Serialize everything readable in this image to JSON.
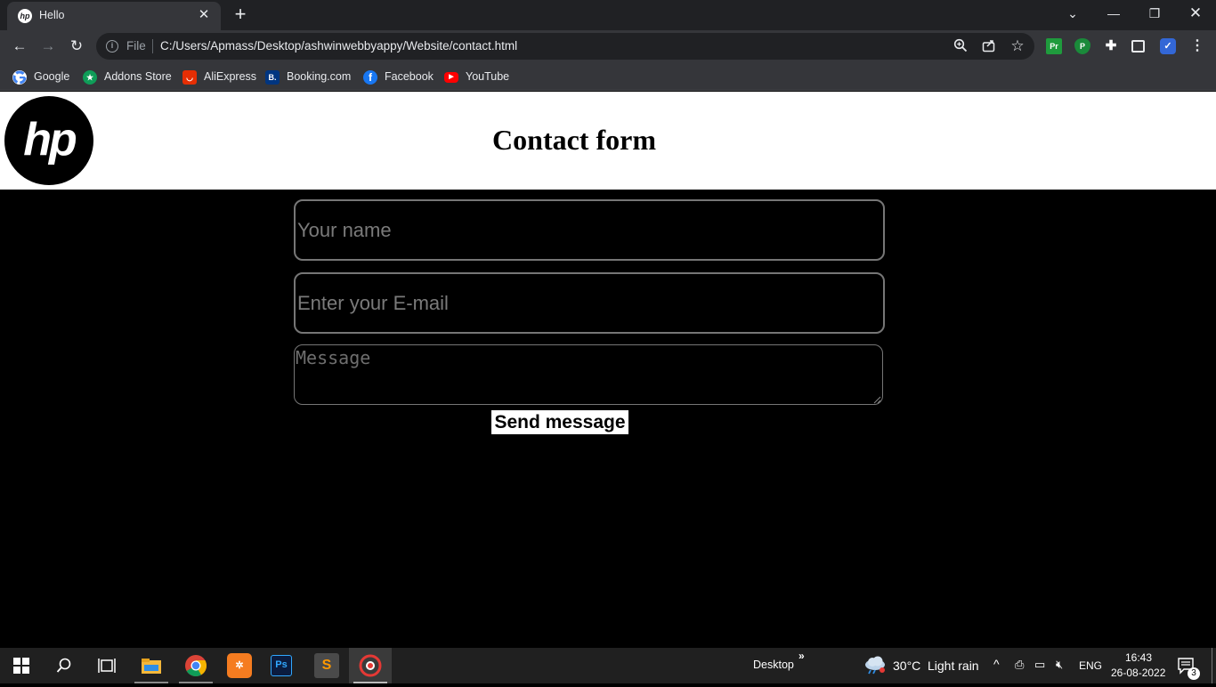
{
  "browser": {
    "tab_title": "Hello",
    "tab_favicon_text": "hp",
    "address_file_label": "File",
    "address_url": "C:/Users/Apmass/Desktop/ashwinwebbyappy/Website/contact.html",
    "extensions": [
      "Pr",
      "P"
    ]
  },
  "bookmarks": [
    {
      "label": "Google",
      "icon": "google-icon",
      "color": "#ffffff"
    },
    {
      "label": "Addons Store",
      "icon": "addons-store-icon",
      "color": "#0f9d58"
    },
    {
      "label": "AliExpress",
      "icon": "aliexpress-icon",
      "color": "#e62e04"
    },
    {
      "label": "Booking.com",
      "icon": "booking-icon",
      "color": "#003580",
      "glyph": "B."
    },
    {
      "label": "Facebook",
      "icon": "facebook-icon",
      "color": "#1877f2",
      "glyph": "f"
    },
    {
      "label": "YouTube",
      "icon": "youtube-icon",
      "color": "#ff0000",
      "glyph": "▶"
    }
  ],
  "page": {
    "title": "Contact form",
    "logo_text": "hp",
    "name_placeholder": "Your name",
    "email_placeholder": "Enter your E-mail",
    "message_placeholder": "Message",
    "send_label": "Send message"
  },
  "taskbar": {
    "photoshop_label": "Ps",
    "desktop_label": "Desktop",
    "desktop_chevron": "»",
    "weather_temp": "30°C",
    "weather_desc": "Light rain",
    "language": "ENG",
    "time": "16:43",
    "date": "26-08-2022",
    "notification_count": "3"
  },
  "colors": {
    "page_background": "#000000",
    "header_background": "#ffffff",
    "chrome_dark": "#202124",
    "chrome_toolbar": "#35363a"
  }
}
